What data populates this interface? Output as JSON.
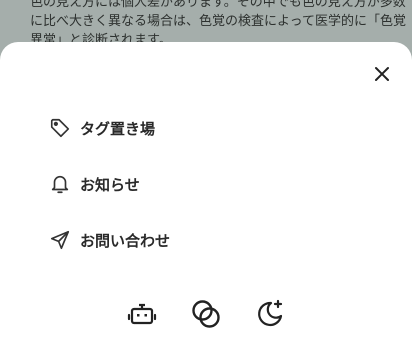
{
  "background_text": {
    "line1": "色の見え方には個人差があります。その中でも色の見え方が多数",
    "line2": "に比べ大きく異なる場合は、色覚の検査によって医学的に「色覚",
    "line3": "異常」と診断されます。"
  },
  "sheet": {
    "menu": [
      {
        "label": "タグ置き場",
        "icon": "tag-icon"
      },
      {
        "label": "お知らせ",
        "icon": "bell-icon"
      },
      {
        "label": "お問い合わせ",
        "icon": "send-icon"
      }
    ],
    "bottom_icons": [
      "robot-icon",
      "overlap-circles-icon",
      "moon-sparkle-icon"
    ]
  },
  "colors": {
    "overlay": "#a4adaa",
    "sheet": "#ffffff",
    "text": "#2a2a2a"
  }
}
